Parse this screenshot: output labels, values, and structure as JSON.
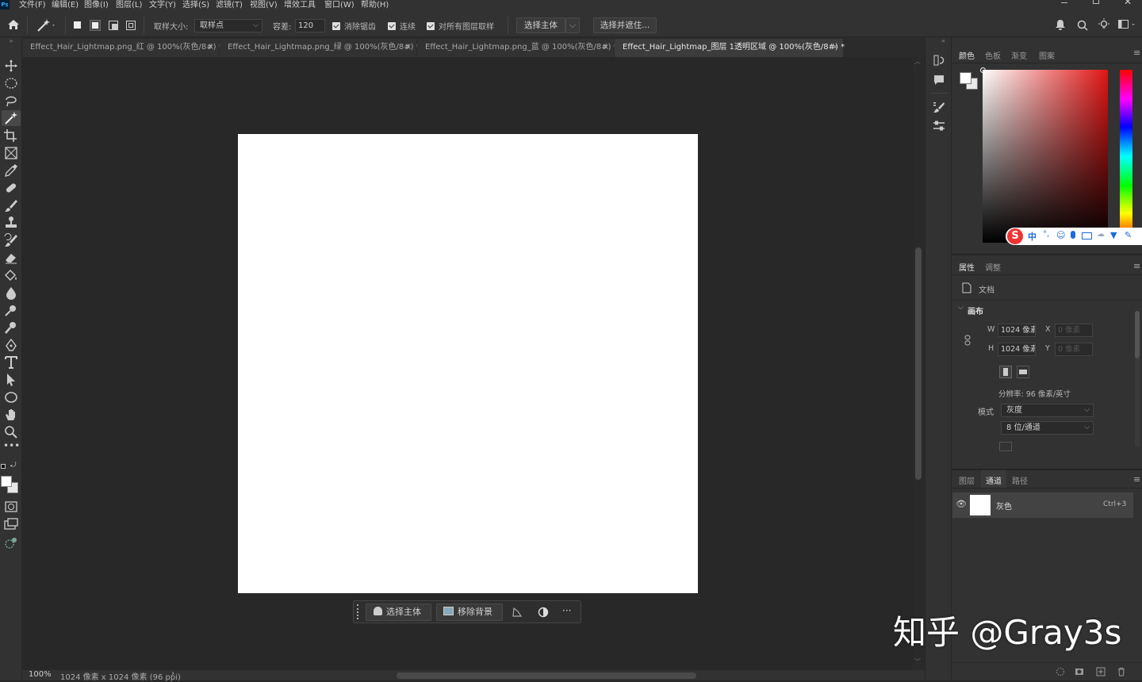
{
  "menubar": {
    "app_icon": "Ps",
    "items": [
      "文件(F)",
      "编辑(E)",
      "图像(I)",
      "图层(L)",
      "文字(Y)",
      "选择(S)",
      "滤镜(T)",
      "视图(V)",
      "增效工具",
      "窗口(W)",
      "帮助(H)"
    ]
  },
  "options": {
    "sample_size_label": "取样大小:",
    "sample_size_value": "取样点",
    "tolerance_label": "容差:",
    "tolerance_value": "120",
    "antialias_label": "消除锯齿",
    "contiguous_label": "连续",
    "sample_all_label": "对所有图层取样",
    "select_subject_label": "选择主体",
    "select_mask_label": "选择并遮住..."
  },
  "tabs": [
    {
      "label": "Effect_Hair_Lightmap.png_红 @ 100%(灰色/8#) *",
      "close": "×"
    },
    {
      "label": "Effect_Hair_Lightmap.png_绿 @ 100%(灰色/8#) *",
      "close": "×"
    },
    {
      "label": "Effect_Hair_Lightmap.png_蓝 @ 100%(灰色/8#) *",
      "close": "×"
    },
    {
      "label": "Effect_Hair_Lightmap_图层 1透明区域 @ 100%(灰色/8#) *",
      "close": "×"
    }
  ],
  "ctxbar": {
    "select_subject": "选择主体",
    "remove_bg": "移除背景",
    "more": "···"
  },
  "status": {
    "zoom": "100%",
    "doc_info": "1024 像素 x 1024 像素 (96 ppi)",
    "arrow": "›"
  },
  "color_panel": {
    "tabs": [
      "颜色",
      "色板",
      "渐变",
      "图案"
    ]
  },
  "ime_toolbar": {
    "label": "中"
  },
  "props_panel": {
    "tabs": [
      "属性",
      "调整"
    ],
    "doc_label": "文档",
    "canvas_label": "画布",
    "w_label": "W",
    "w_value": "1024 像素",
    "h_label": "H",
    "h_value": "1024 像素",
    "x_label": "X",
    "x_value": "0 像素",
    "y_label": "Y",
    "y_value": "0 像素",
    "resolution": "分辨率: 96 像素/英寸",
    "mode_label": "模式",
    "mode_value": "灰度",
    "depth_value": "8 位/通道"
  },
  "channels_panel": {
    "tabs": [
      "图层",
      "通道",
      "路径"
    ],
    "channel_name": "灰色",
    "channel_shortcut": "Ctrl+3"
  },
  "watermark": "知乎 @Gray3s",
  "colors": {
    "panel_bg": "#323232",
    "canvas_bg": "#282828",
    "document": "#ffffff",
    "accent_red": "#e02020"
  }
}
